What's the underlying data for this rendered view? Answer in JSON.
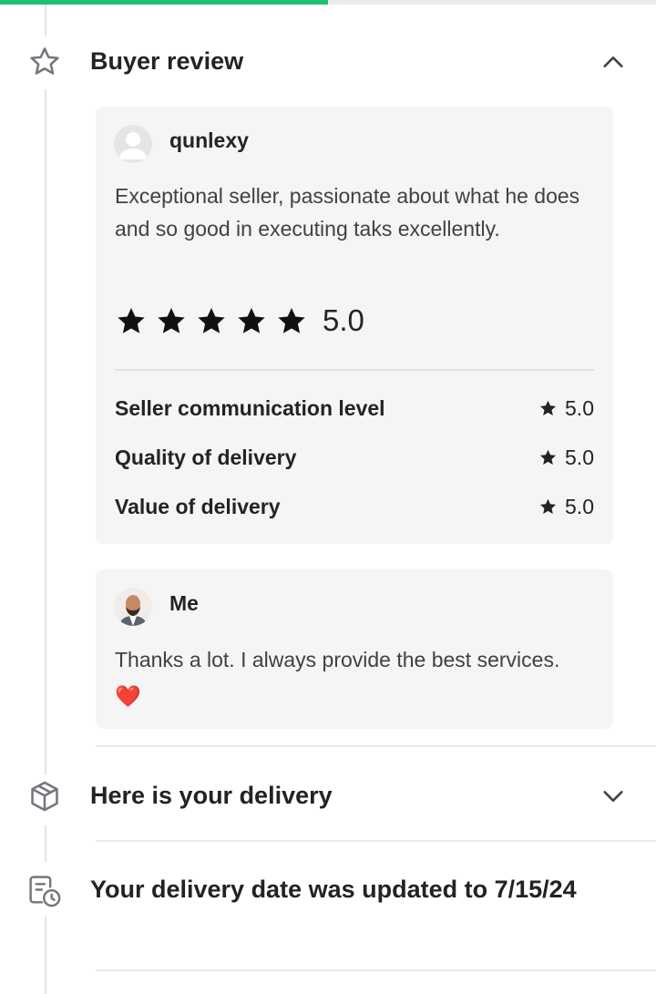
{
  "progress": {
    "fraction": 0.5,
    "color": "#1dbf73"
  },
  "review_section": {
    "title": "Buyer review",
    "icon": "star-outline-icon",
    "toggle_icon": "chevron-up-icon",
    "buyer_review": {
      "username": "qunlexy",
      "avatar_icon": "default-user-avatar",
      "text": "Exceptional seller, passionate about what he does and so good in executing taks excellently.",
      "overall_rating": "5.0",
      "stars": 5,
      "breakdown": [
        {
          "label": "Seller communication level",
          "value": "5.0"
        },
        {
          "label": "Quality of delivery",
          "value": "5.0"
        },
        {
          "label": "Value of delivery",
          "value": "5.0"
        }
      ]
    },
    "seller_reply": {
      "username": "Me",
      "avatar_icon": "user-photo-avatar",
      "text": "Thanks a lot. I always provide the best services.",
      "emoji": "❤️"
    }
  },
  "events": [
    {
      "title": "Here is your delivery",
      "icon": "package-icon",
      "toggle_icon": "chevron-down-icon"
    },
    {
      "title": "Your delivery date was updated to 7/15/24",
      "icon": "calendar-clock-icon"
    }
  ]
}
